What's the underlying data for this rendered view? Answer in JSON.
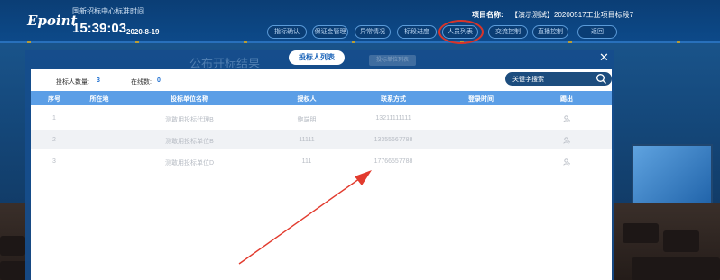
{
  "header": {
    "logo": "Epoint",
    "center_name": "国新招标中心标准时间",
    "clock": "15:39:03",
    "date": "2020-8-19",
    "project_label": "项目名称:",
    "project_name": "【演示测试】20200517工业项目标段7"
  },
  "nav": [
    {
      "label": "指标确认"
    },
    {
      "label": "保证金管理"
    },
    {
      "label": "异常情况"
    },
    {
      "label": "标段进度"
    },
    {
      "label": "人员列表"
    },
    {
      "label": "交流控制"
    },
    {
      "label": "直播控制"
    },
    {
      "label": "返回"
    }
  ],
  "background_title": "公布开标结果",
  "popup": {
    "active_tab": "投标人列表",
    "faint_tab": "投标单位列表",
    "bidder_count_label": "投标人数量:",
    "bidder_count": "3",
    "online_count_label": "在线数:",
    "online_count": "0",
    "search_placeholder": "关键字搜索"
  },
  "table": {
    "columns": [
      "序号",
      "所在地",
      "投标单位名称",
      "授权人",
      "联系方式",
      "登录时间",
      "踢出"
    ],
    "rows": [
      {
        "no": "1",
        "location": "",
        "company": "测敢用投标代理B",
        "agent": "鲍端明",
        "phone": "13211111111",
        "login": ""
      },
      {
        "no": "2",
        "location": "",
        "company": "测敢用投标单位B",
        "agent": "11111",
        "phone": "13355667788",
        "login": ""
      },
      {
        "no": "3",
        "location": "",
        "company": "测敢用投标单位D",
        "agent": "111",
        "phone": "17766557788",
        "login": ""
      }
    ]
  },
  "colors": {
    "header_bg": "#0d4a8a",
    "table_head": "#5b9ee6",
    "highlight_circle": "#d7342a",
    "arrow": "#e23b2e",
    "accent_blue": "#1e6fd0"
  }
}
